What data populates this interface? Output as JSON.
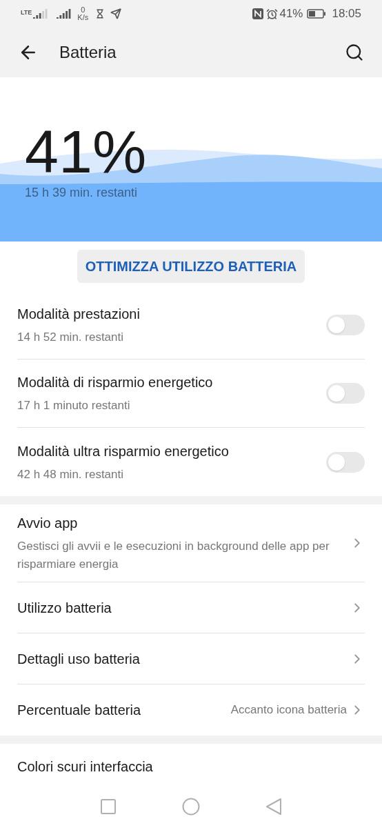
{
  "status_bar": {
    "network_type": "LTE",
    "speed_value": "0",
    "speed_unit": "K/s",
    "battery_percent": "41%",
    "time": "18:05"
  },
  "header": {
    "title": "Batteria"
  },
  "battery": {
    "percent": "41%",
    "remaining": "15 h 39 min. restanti"
  },
  "optimize_button": "OTTIMIZZA UTILIZZO BATTERIA",
  "modes": [
    {
      "title": "Modalità prestazioni",
      "subtitle": "14 h 52 min. restanti",
      "on": false
    },
    {
      "title": "Modalità di risparmio energetico",
      "subtitle": "17 h 1 minuto restanti",
      "on": false
    },
    {
      "title": "Modalità ultra risparmio energetico",
      "subtitle": "42 h 48 min. restanti",
      "on": false
    }
  ],
  "settings": [
    {
      "title": "Avvio app",
      "subtitle": "Gestisci gli avvii e le esecuzioni in background delle app per risparmiare energia"
    },
    {
      "title": "Utilizzo batteria"
    },
    {
      "title": "Dettagli uso batteria"
    },
    {
      "title": "Percentuale batteria",
      "value": "Accanto icona batteria"
    }
  ],
  "more_settings": [
    {
      "title": "Colori scuri interfaccia"
    }
  ]
}
